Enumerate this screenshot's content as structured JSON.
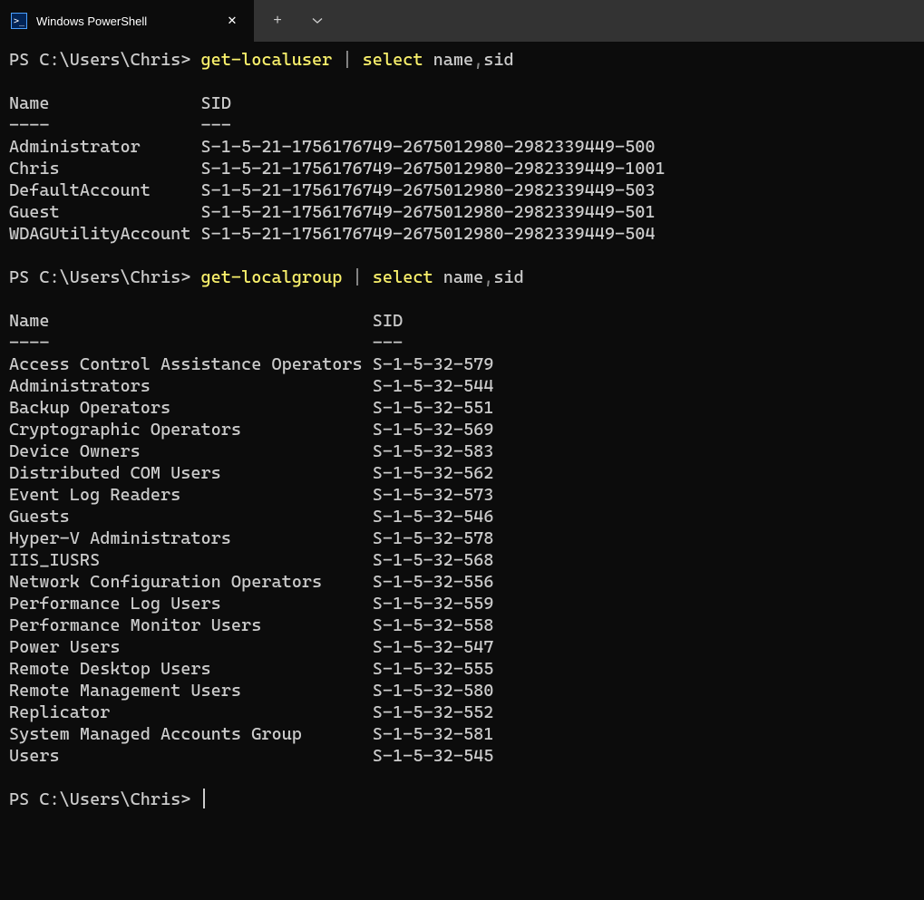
{
  "tab": {
    "title": "Windows PowerShell",
    "icon_label": ">_"
  },
  "prompt": "PS C:\\Users\\Chris>",
  "commands": {
    "cmd1": {
      "part1": "get-localuser",
      "pipe": " | ",
      "part2": "select",
      "args": " name",
      "comma": ",",
      "args2": "sid"
    },
    "cmd2": {
      "part1": "get-localgroup",
      "pipe": " | ",
      "part2": "select",
      "args": " name",
      "comma": ",",
      "args2": "sid"
    }
  },
  "table1": {
    "col1_header": "Name",
    "col2_header": "SID",
    "col1_underline": "----",
    "col2_underline": "---",
    "col1_width": 19,
    "rows": [
      {
        "name": "Administrator",
        "sid": "S-1-5-21-1756176749-2675012980-2982339449-500"
      },
      {
        "name": "Chris",
        "sid": "S-1-5-21-1756176749-2675012980-2982339449-1001"
      },
      {
        "name": "DefaultAccount",
        "sid": "S-1-5-21-1756176749-2675012980-2982339449-503"
      },
      {
        "name": "Guest",
        "sid": "S-1-5-21-1756176749-2675012980-2982339449-501"
      },
      {
        "name": "WDAGUtilityAccount",
        "sid": "S-1-5-21-1756176749-2675012980-2982339449-504"
      }
    ]
  },
  "table2": {
    "col1_header": "Name",
    "col2_header": "SID",
    "col1_underline": "----",
    "col2_underline": "---",
    "col1_width": 36,
    "rows": [
      {
        "name": "Access Control Assistance Operators",
        "sid": "S-1-5-32-579"
      },
      {
        "name": "Administrators",
        "sid": "S-1-5-32-544"
      },
      {
        "name": "Backup Operators",
        "sid": "S-1-5-32-551"
      },
      {
        "name": "Cryptographic Operators",
        "sid": "S-1-5-32-569"
      },
      {
        "name": "Device Owners",
        "sid": "S-1-5-32-583"
      },
      {
        "name": "Distributed COM Users",
        "sid": "S-1-5-32-562"
      },
      {
        "name": "Event Log Readers",
        "sid": "S-1-5-32-573"
      },
      {
        "name": "Guests",
        "sid": "S-1-5-32-546"
      },
      {
        "name": "Hyper-V Administrators",
        "sid": "S-1-5-32-578"
      },
      {
        "name": "IIS_IUSRS",
        "sid": "S-1-5-32-568"
      },
      {
        "name": "Network Configuration Operators",
        "sid": "S-1-5-32-556"
      },
      {
        "name": "Performance Log Users",
        "sid": "S-1-5-32-559"
      },
      {
        "name": "Performance Monitor Users",
        "sid": "S-1-5-32-558"
      },
      {
        "name": "Power Users",
        "sid": "S-1-5-32-547"
      },
      {
        "name": "Remote Desktop Users",
        "sid": "S-1-5-32-555"
      },
      {
        "name": "Remote Management Users",
        "sid": "S-1-5-32-580"
      },
      {
        "name": "Replicator",
        "sid": "S-1-5-32-552"
      },
      {
        "name": "System Managed Accounts Group",
        "sid": "S-1-5-32-581"
      },
      {
        "name": "Users",
        "sid": "S-1-5-32-545"
      }
    ]
  }
}
